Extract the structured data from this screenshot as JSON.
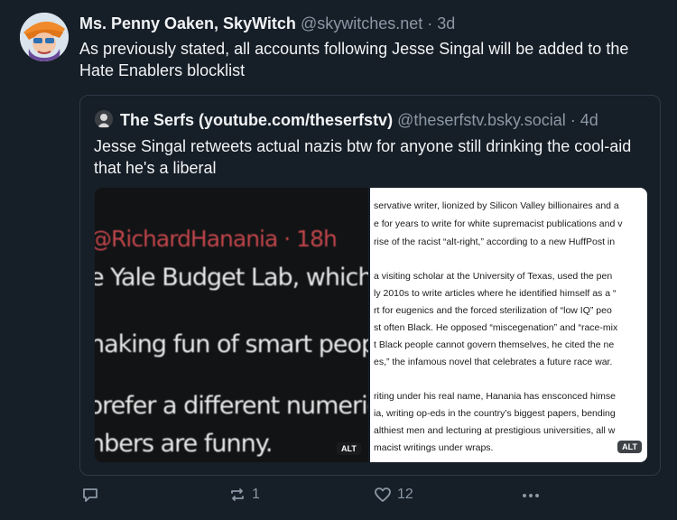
{
  "post": {
    "author_name": "Ms. Penny Oaken, SkyWitch",
    "handle": "@skywitches.net",
    "separator": "·",
    "time": "3d",
    "text": "As previously stated, all accounts following Jesse Singal will be added to the Hate Enablers blocklist"
  },
  "quote": {
    "author_name": "The Serfs (youtube.com/theserfstv)",
    "handle": "@theserfstv.bsky.social",
    "separator": "·",
    "time": "4d",
    "text": "Jesse Singal retweets actual nazis btw for anyone still drinking the cool-aid that he's a liberal",
    "images": [
      {
        "alt_label": "ALT",
        "lines": [
          "@RichardHanania · 18h",
          "e Yale Budget Lab, which",
          "naking fun of smart peop",
          "prefer a different numeric",
          "nbers are funny."
        ]
      },
      {
        "alt_label": "ALT",
        "lines": [
          "servative writer, lionized by Silicon Valley billionaires and a",
          "e for years to write for white supremacist publications and v",
          "rise of the racist “alt-right,” according to a new HuffPost in",
          "a visiting scholar at the University of Texas, used the pen",
          "ly 2010s to write articles where he identified himself as a “",
          "rt for eugenics and the forced sterilization of “low IQ” peo",
          "st often Black. He opposed “miscegenation” and “race-mix",
          "t Black people cannot govern themselves, he cited the ne",
          "es,” the infamous novel that celebrates a future race war.",
          "riting under his real name, Hanania has ensconced himse",
          "ia, writing op-eds in the country’s biggest papers, bending",
          "althiest men and lecturing at prestigious universities, all w",
          "macist writings under wraps."
        ]
      }
    ]
  },
  "actions": {
    "reply_icon": "reply-icon",
    "repost_icon": "repost-icon",
    "repost_count": "1",
    "like_icon": "heart-icon",
    "like_count": "12",
    "more_icon": "more-icon"
  }
}
